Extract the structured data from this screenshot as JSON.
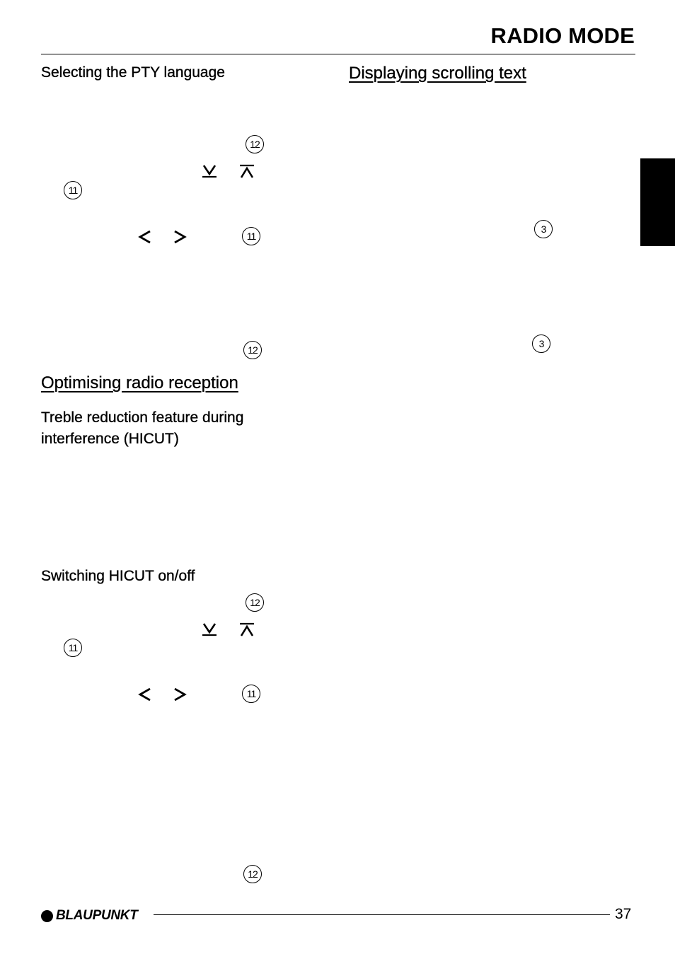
{
  "header": {
    "title": "RADIO MODE"
  },
  "left_column": {
    "pty_language": {
      "heading": "Selecting the PTY language",
      "refs": [
        "12",
        "11",
        "11",
        "12"
      ],
      "icons": [
        "seek-down-icon",
        "seek-up-icon",
        "arrow-left-icon",
        "arrow-right-icon"
      ]
    },
    "optimising": {
      "heading": "Optimising radio reception",
      "subheading": "Treble reduction feature during interference (HICUT)"
    },
    "hicut_switch": {
      "heading": "Switching HICUT on/off",
      "refs": [
        "12",
        "11",
        "11",
        "12"
      ],
      "icons": [
        "seek-down-icon",
        "seek-up-icon",
        "arrow-left-icon",
        "arrow-right-icon"
      ]
    }
  },
  "right_column": {
    "scrolling_text": {
      "heading": "Displaying scrolling text",
      "refs": [
        "3",
        "3"
      ]
    }
  },
  "footer": {
    "brand": "BLAUPUNKT",
    "page_number": "37"
  }
}
